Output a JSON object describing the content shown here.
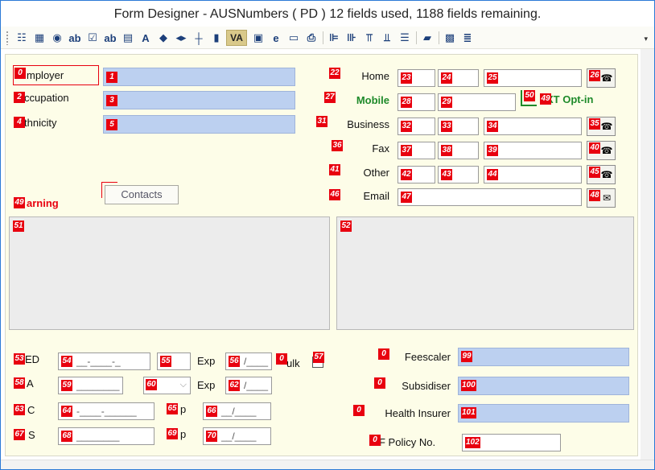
{
  "window": {
    "title": "Form Designer - AUSNumbers ( PD ) 12 fields used, 1188 fields remaining."
  },
  "toolbar": {
    "tools": [
      {
        "name": "tree-icon",
        "glyph": "☷"
      },
      {
        "name": "grid-icon",
        "glyph": "▦"
      },
      {
        "name": "radio-icon",
        "glyph": "◉"
      },
      {
        "name": "textbox-icon",
        "glyph": "ab"
      },
      {
        "name": "checkbox-icon",
        "glyph": "☑"
      },
      {
        "name": "label-icon",
        "glyph": "ab"
      },
      {
        "name": "form-icon",
        "glyph": "▤"
      },
      {
        "name": "font-icon",
        "glyph": "A"
      },
      {
        "name": "shapes-icon",
        "glyph": "◆"
      },
      {
        "name": "spin-icon",
        "glyph": "◂▸"
      },
      {
        "name": "line-icon",
        "glyph": "┼"
      },
      {
        "name": "chart-icon",
        "glyph": "▮"
      },
      {
        "name": "va-icon",
        "glyph": "VA"
      },
      {
        "name": "image-icon",
        "glyph": "▣"
      },
      {
        "name": "ie-icon",
        "glyph": "e"
      },
      {
        "name": "button-icon",
        "glyph": "▭"
      },
      {
        "name": "print-icon",
        "glyph": "⎙"
      },
      {
        "name": "align-left-icon",
        "glyph": "⊫"
      },
      {
        "name": "align-right-icon",
        "glyph": "⊪"
      },
      {
        "name": "align-top-icon",
        "glyph": "⫪"
      },
      {
        "name": "align-bottom-icon",
        "glyph": "⫫"
      },
      {
        "name": "tab-order-icon",
        "glyph": "☰"
      },
      {
        "name": "book-icon",
        "glyph": "▰"
      },
      {
        "name": "layout-icon",
        "glyph": "▩"
      },
      {
        "name": "list-icon",
        "glyph": "≣"
      }
    ],
    "more": "▾"
  },
  "left": {
    "employer": {
      "label": "mployer",
      "tag": "0",
      "ftag": "1"
    },
    "occupation": {
      "label": "ccupation",
      "tag": "2",
      "ftag": "3"
    },
    "ethnicity": {
      "label": "thnicity",
      "tag": "4",
      "ftag": "5"
    },
    "contacts_button": "Contacts",
    "warning": {
      "label": "arning",
      "tag": "49"
    }
  },
  "phones": [
    {
      "key": "home",
      "label": "Home",
      "tag": "22",
      "a": "23",
      "b": "24",
      "c": "25",
      "btn": "26"
    },
    {
      "key": "mobile",
      "label": "Mobile",
      "tag": "27",
      "a": "28",
      "b": "29",
      "opt_tag": "50",
      "opt_tag2": "49",
      "opt_label": "XT Opt-in"
    },
    {
      "key": "business",
      "label": "Business",
      "tag": "31",
      "a": "32",
      "b": "33",
      "c": "34",
      "btn": "35"
    },
    {
      "key": "fax",
      "label": "Fax",
      "tag": "36",
      "a": "37",
      "b": "38",
      "c": "39",
      "btn": "40"
    },
    {
      "key": "other",
      "label": "Other",
      "tag": "41",
      "a": "42",
      "b": "43",
      "c": "44",
      "btn": "45"
    }
  ],
  "email": {
    "label": "Email",
    "tag": "46",
    "ftag": "47",
    "btn": "48"
  },
  "memos": {
    "left": "51",
    "right": "52"
  },
  "ids": {
    "ed": {
      "label": "ED",
      "tag": "53",
      "ftag": "54",
      "mask": "__-____-_",
      "num": "55",
      "exp_label": "Exp",
      "exp_tag": "56",
      "exp_mask": "/____"
    },
    "bulk": {
      "tag": "0",
      "label": "ulk",
      "chk": "57"
    },
    "va": {
      "label": "A",
      "tag": "58",
      "ftag": "59",
      "mask": "________",
      "combo": "60",
      "exp_label": "Exp",
      "exp_tag": "62",
      "exp_mask": "/____"
    },
    "hc": {
      "label": "C",
      "tag": "63",
      "ftag": "64",
      "mask": "-____-______",
      "p_tag": "65",
      "p_label": "p",
      "d_tag": "66",
      "d_mask": "__/____"
    },
    "hs": {
      "label": "S",
      "tag": "67",
      "ftag": "68",
      "mask": "________",
      "p_tag": "69",
      "p_label": "p",
      "d_tag": "70",
      "d_mask": "__/____"
    }
  },
  "right": {
    "feescaler": {
      "label": "Feescaler",
      "tag": "0",
      "ftag": "99"
    },
    "subsidiser": {
      "label": "Subsidiser",
      "tag": "0",
      "ftag": "100"
    },
    "health_insurer": {
      "label": "Health Insurer",
      "tag": "0",
      "ftag": "101"
    },
    "policy": {
      "label": "F Policy No.",
      "tag": "0",
      "ftag": "102"
    }
  }
}
